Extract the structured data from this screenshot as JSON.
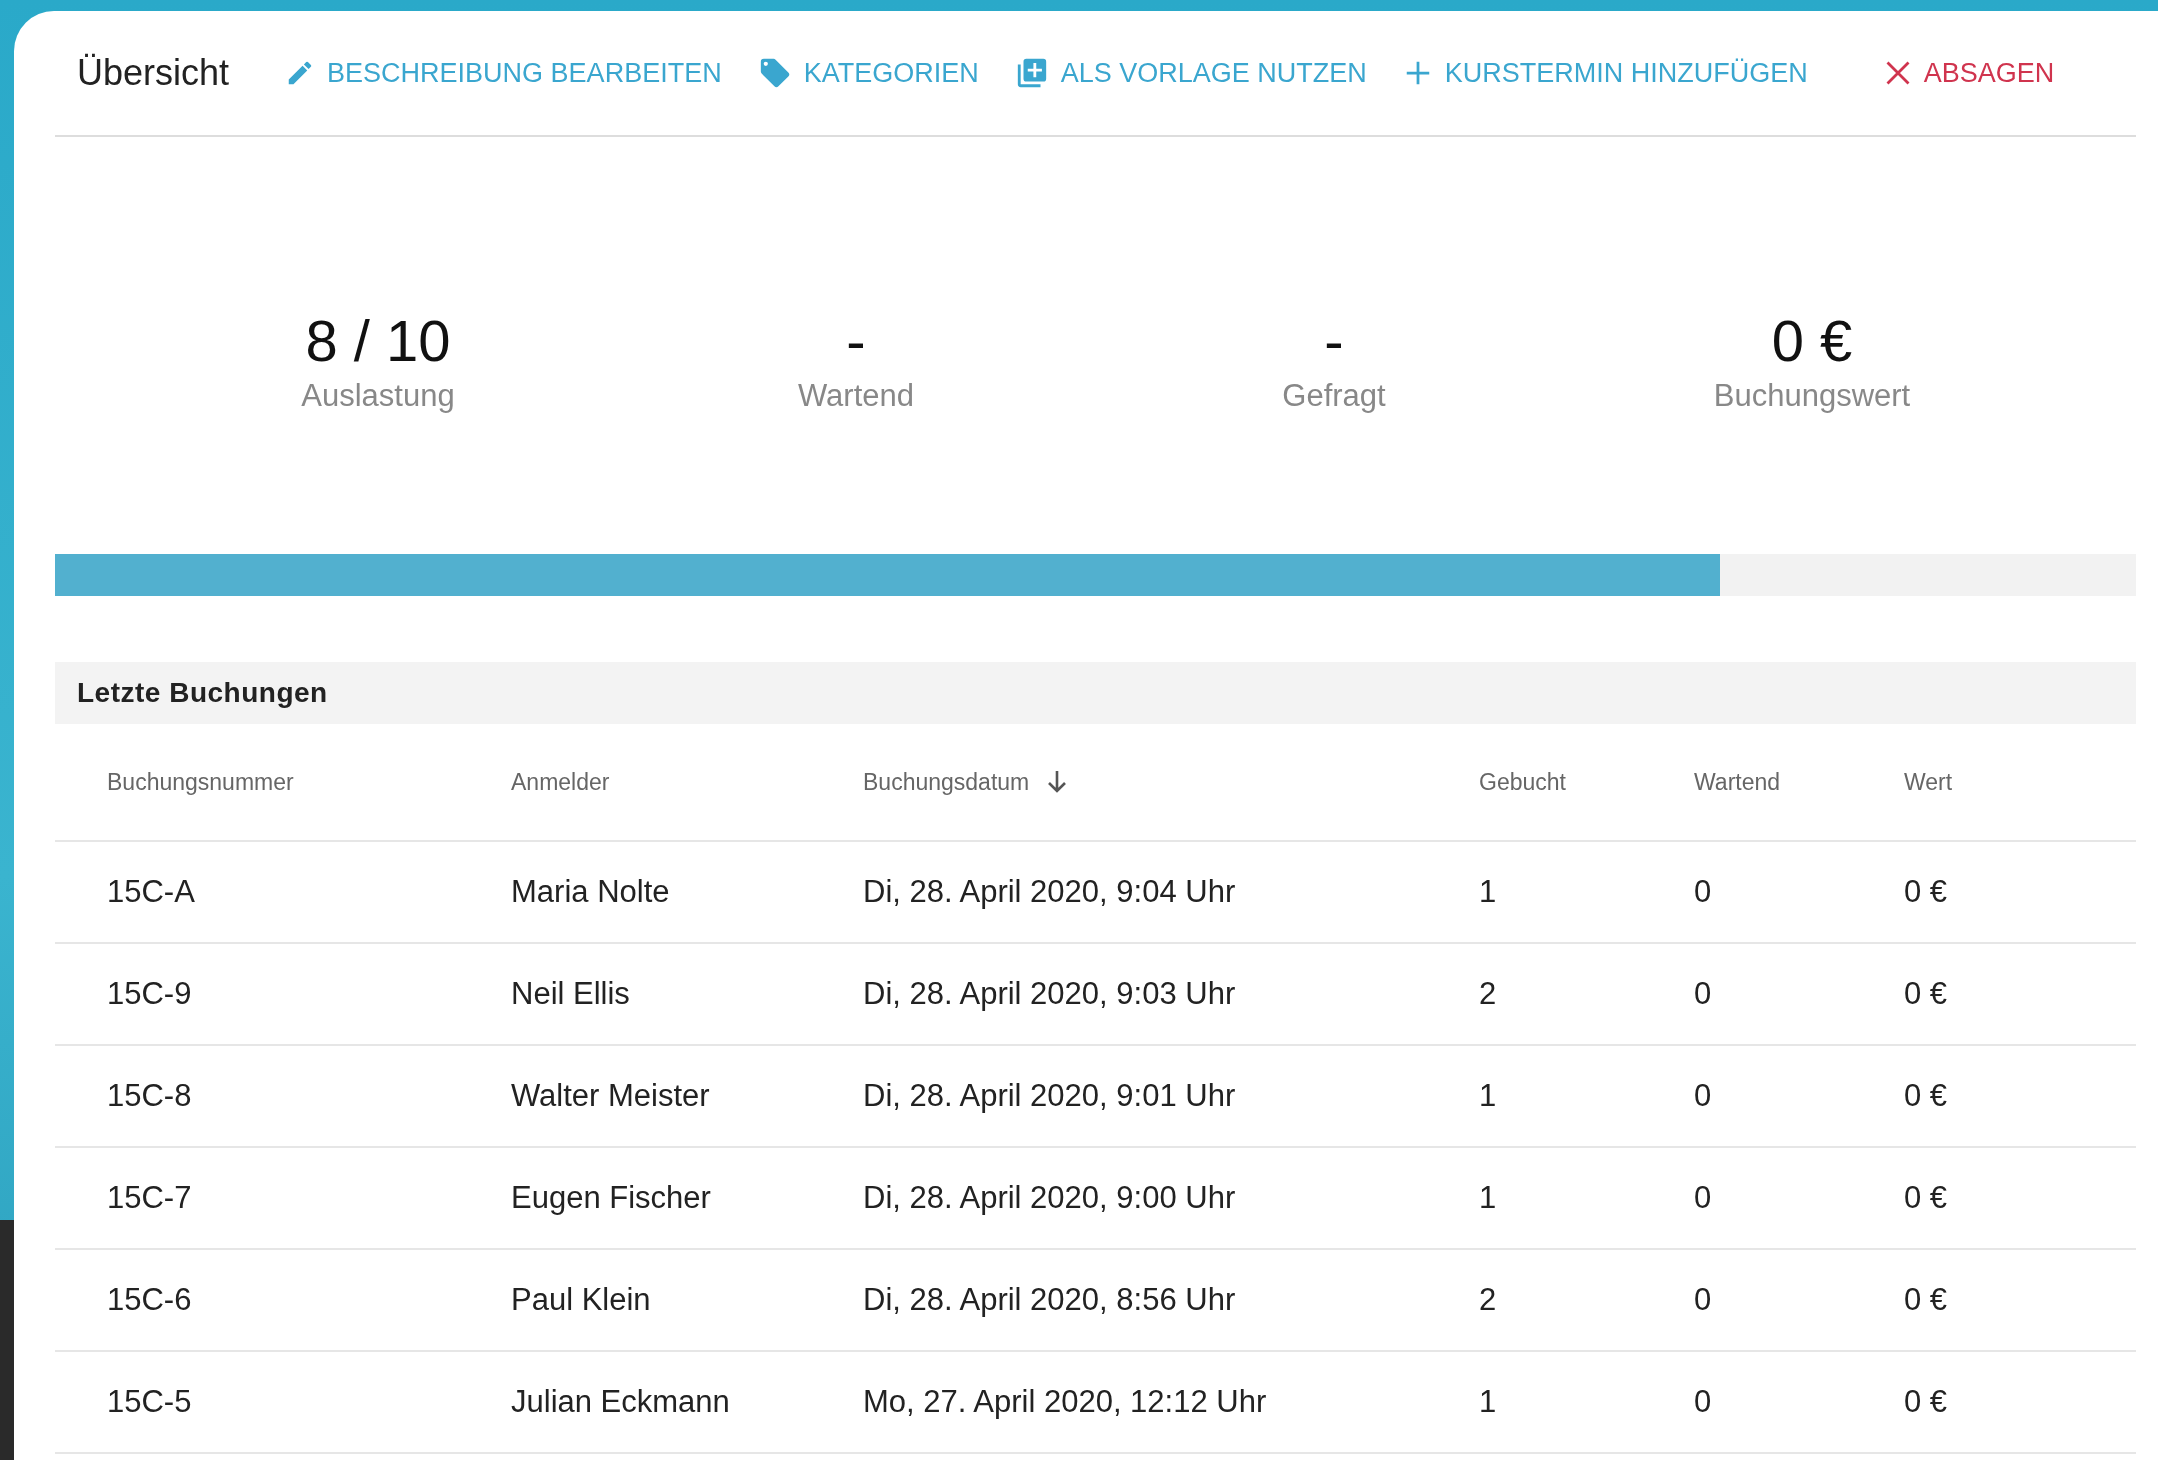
{
  "toolbar": {
    "title": "Übersicht",
    "actions": [
      {
        "label": "BESCHREIBUNG BEARBEITEN",
        "kind": "action"
      },
      {
        "label": "KATEGORIEN",
        "kind": "action"
      },
      {
        "label": "ALS VORLAGE NUTZEN",
        "kind": "action"
      },
      {
        "label": "KURSTERMIN HINZUFÜGEN",
        "kind": "action"
      },
      {
        "label": "ABSAGEN",
        "kind": "danger"
      }
    ]
  },
  "stats": [
    {
      "value": "8 / 10",
      "label": "Auslastung"
    },
    {
      "value": "-",
      "label": "Wartend"
    },
    {
      "value": "-",
      "label": "Gefragt"
    },
    {
      "value": "0 €",
      "label": "Buchungswert"
    }
  ],
  "progress": {
    "level": 0.8
  },
  "bookings": {
    "title": "Letzte Buchungen",
    "columns": [
      {
        "label": "Buchungsnummer",
        "sorted": false
      },
      {
        "label": "Anmelder",
        "sorted": false
      },
      {
        "label": "Buchungsdatum",
        "sorted": true
      },
      {
        "label": "Gebucht",
        "sorted": false
      },
      {
        "label": "Wartend",
        "sorted": false
      },
      {
        "label": "Wert",
        "sorted": false
      }
    ],
    "rows": [
      [
        "15C-A",
        "Maria Nolte",
        "Di, 28. April 2020, 9:04 Uhr",
        "1",
        "0",
        "0 €"
      ],
      [
        "15C-9",
        "Neil Ellis",
        "Di, 28. April 2020, 9:03 Uhr",
        "2",
        "0",
        "0 €"
      ],
      [
        "15C-8",
        "Walter Meister",
        "Di, 28. April 2020, 9:01 Uhr",
        "1",
        "0",
        "0 €"
      ],
      [
        "15C-7",
        "Eugen Fischer",
        "Di, 28. April 2020, 9:00 Uhr",
        "1",
        "0",
        "0 €"
      ],
      [
        "15C-6",
        "Paul Klein",
        "Di, 28. April 2020, 8:56 Uhr",
        "2",
        "0",
        "0 €"
      ],
      [
        "15C-5",
        "Julian Eckmann",
        "Mo, 27. April 2020, 12:12 Uhr",
        "1",
        "0",
        "0 €"
      ]
    ]
  }
}
